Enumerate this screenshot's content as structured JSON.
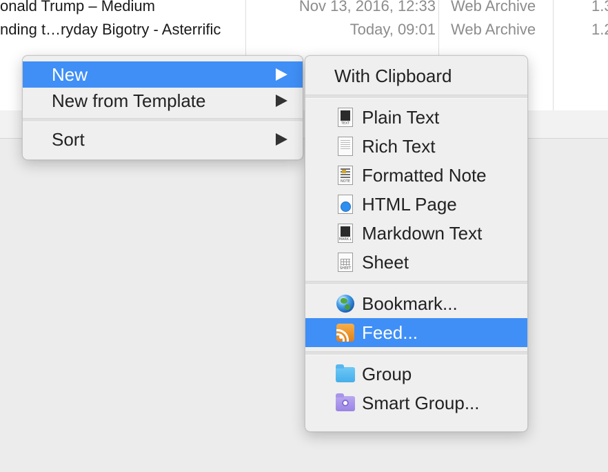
{
  "file_list": {
    "rows": [
      {
        "name": "onald Trump – Medium",
        "date": "Nov 13, 2016, 12:33",
        "kind": "Web Archive",
        "size": "1.3"
      },
      {
        "name": "nding t…ryday Bigotry - Asterrific",
        "date": "Today, 09:01",
        "kind": "Web Archive",
        "size": "1.2"
      }
    ]
  },
  "context_menu": {
    "items": [
      {
        "label": "New",
        "has_submenu": true,
        "highlighted": true
      },
      {
        "label": "New from Template",
        "has_submenu": true
      },
      {
        "label": "Sort",
        "has_submenu": true
      }
    ]
  },
  "submenu": {
    "with_clipboard": "With Clipboard",
    "documents": [
      {
        "label": "Plain Text",
        "icon": "plain-text-icon",
        "tag": "TEXT"
      },
      {
        "label": "Rich Text",
        "icon": "rich-text-icon",
        "tag": ""
      },
      {
        "label": "Formatted Note",
        "icon": "formatted-note-icon",
        "tag": "NOTE"
      },
      {
        "label": "HTML Page",
        "icon": "html-page-icon",
        "tag": ""
      },
      {
        "label": "Markdown Text",
        "icon": "markdown-icon",
        "tag": "MARK↓"
      },
      {
        "label": "Sheet",
        "icon": "sheet-icon",
        "tag": "SHEET"
      }
    ],
    "web": [
      {
        "label": "Bookmark...",
        "icon": "globe-icon"
      },
      {
        "label": "Feed...",
        "icon": "rss-feed-icon",
        "highlighted": true
      }
    ],
    "groups": [
      {
        "label": "Group",
        "icon": "folder-icon"
      },
      {
        "label": "Smart Group...",
        "icon": "smart-folder-icon"
      }
    ]
  },
  "colors": {
    "highlight": "#3f8ff6",
    "menu_background": "#efefef",
    "window_background": "#ececec"
  }
}
